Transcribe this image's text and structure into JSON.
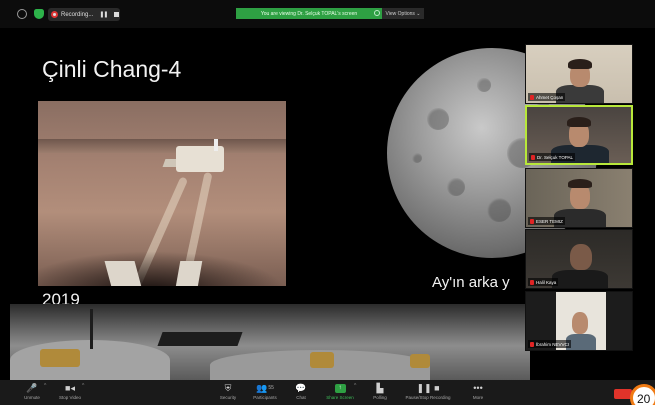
{
  "topbar": {
    "recording_label": "Recording...",
    "pause_glyph": "❚❚",
    "share_banner": "You are viewing Dr. Selçuk TOPAL's screen",
    "view_options": "View Options ⌄"
  },
  "slide": {
    "title": "Çinli Chang-4",
    "year": "2019",
    "caption": "Ay'ın arka y"
  },
  "participants": [
    {
      "name": "Ahmet Çoşan",
      "muted": true,
      "active": false
    },
    {
      "name": "Dr. Selçuk TOPAL",
      "muted": true,
      "active": true
    },
    {
      "name": "ESER TEMIZ",
      "muted": true,
      "active": false
    },
    {
      "name": "Halil Kaya",
      "muted": true,
      "active": false
    },
    {
      "name": "İbrahim NEVVCI",
      "muted": true,
      "active": false
    }
  ],
  "toolbar": {
    "unmute": "Unmute",
    "stop_video": "Stop Video",
    "security": "Security",
    "participants": "Participants",
    "participants_count": "55",
    "chat": "Chat",
    "share_screen": "Share Screen",
    "polling": "Polling",
    "pause_stop_recording": "Pause/Stop Recording",
    "more": "More"
  },
  "badge": "20",
  "colors": {
    "share_green": "#2ea043",
    "active_speaker": "#b8e83a",
    "end_red": "#e0332a",
    "badge_orange": "#f07b14"
  }
}
